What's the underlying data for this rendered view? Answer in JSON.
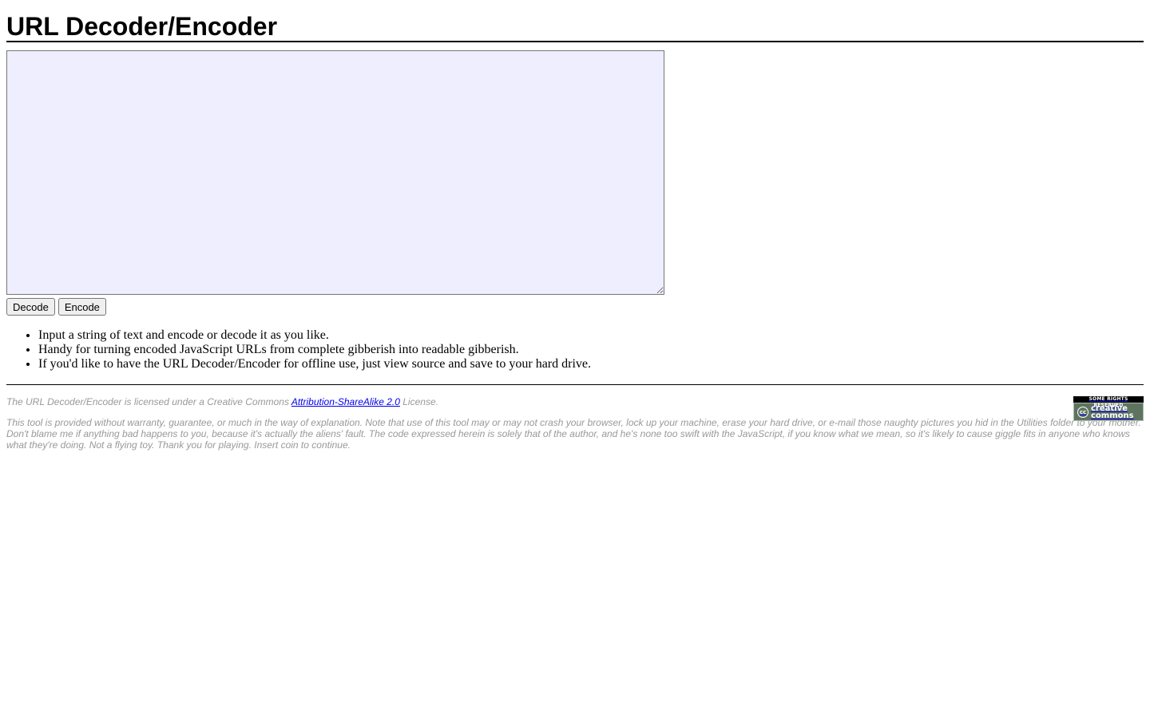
{
  "page": {
    "title": "URL Decoder/Encoder"
  },
  "input": {
    "value": "",
    "background": "#eeeeff"
  },
  "buttons": {
    "decode_label": "Decode",
    "encode_label": "Encode"
  },
  "notes": [
    "Input a string of text and encode or decode it as you like.",
    "Handy for turning encoded JavaScript URLs from complete gibberish into readable gibberish.",
    "If you'd like to have the URL Decoder/Encoder for offline use, just view source and save to your hard drive."
  ],
  "footer": {
    "license_prefix": "The URL Decoder/Encoder is licensed under a Creative Commons ",
    "license_link": "Attribution-ShareAlike 2.0",
    "license_suffix": " License.",
    "disclaimer": "This tool is provided without warranty, guarantee, or much in the way of explanation. Note that use of this tool may or may not crash your browser, lock up your machine, erase your hard drive, or e-mail those naughty pictures you hid in the Utilities folder to your mother. Don't blame me if anything bad happens to you, because it's actually the aliens' fault. The code expressed herein is solely that of the author, and he's none too swift with the JavaScript, if you know what we mean, so it's likely to cause giggle fits in anyone who knows what they're doing. Not a flying toy. Thank you for playing. Insert coin to continue.",
    "text_color": "#999999"
  },
  "cc_badge": {
    "top_text": "SOME RIGHTS RESERVED",
    "logo_text": "cc",
    "line1": "creative",
    "line2": "commons",
    "icon": "creative-commons-icon"
  }
}
